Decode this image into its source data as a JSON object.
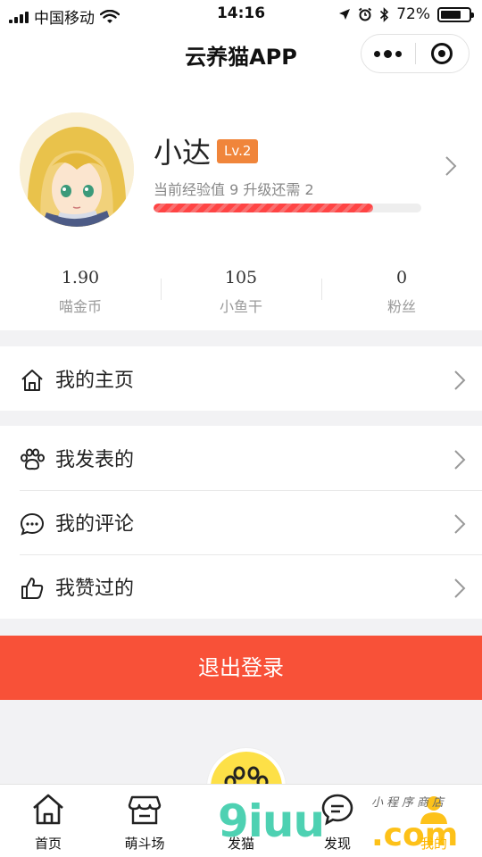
{
  "status_bar": {
    "carrier": "中国移动",
    "time": "14:16",
    "battery_percent": "72%",
    "battery_level": 0.72,
    "icons": [
      "signal-icon",
      "wifi-icon",
      "location-icon",
      "alarm-icon",
      "bluetooth-icon",
      "battery-icon"
    ]
  },
  "nav": {
    "title": "云养猫APP"
  },
  "profile": {
    "name": "小达",
    "level": "Lv.2",
    "exp_text": "当前经验值 9   升级还需 2",
    "exp_progress": 0.82,
    "stats": [
      {
        "value": "1.90",
        "label": "喵金币"
      },
      {
        "value": "105",
        "label": "小鱼干"
      },
      {
        "value": "0",
        "label": "粉丝"
      }
    ]
  },
  "menu": {
    "home": {
      "label": "我的主页",
      "icon": "home-icon"
    },
    "posts": {
      "label": "我发表的",
      "icon": "paw-icon"
    },
    "comments": {
      "label": "我的评论",
      "icon": "comment-icon"
    },
    "likes": {
      "label": "我赞过的",
      "icon": "thumbs-up-icon"
    }
  },
  "logout_label": "退出登录",
  "tabs": [
    {
      "label": "首页",
      "icon": "home-icon"
    },
    {
      "label": "萌斗场",
      "icon": "store-icon"
    },
    {
      "label": "发猫",
      "icon": "paw-icon"
    },
    {
      "label": "发现",
      "icon": "chat-icon"
    },
    {
      "label": "我的",
      "icon": "user-icon"
    }
  ],
  "watermark": {
    "main": "9iuu",
    "tld": ".com",
    "sub": "小程序商店"
  },
  "colors": {
    "accent_red": "#f85138",
    "level_orange": "#f0853b",
    "center_yellow": "#fde047"
  }
}
